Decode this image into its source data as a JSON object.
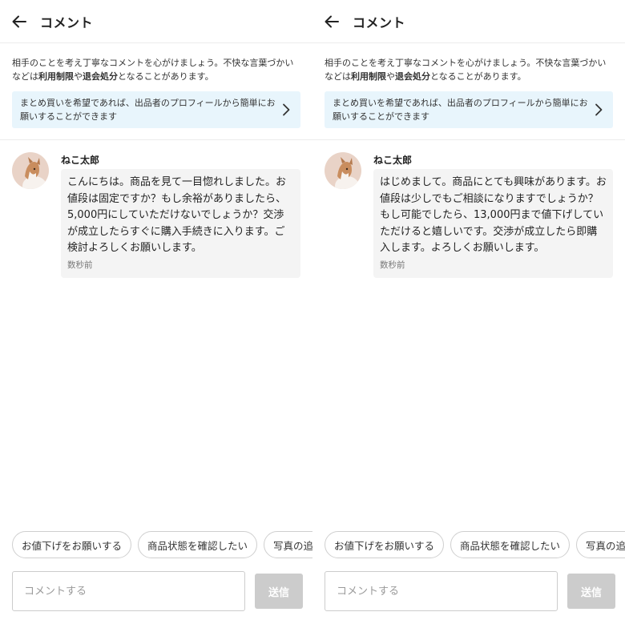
{
  "panels": [
    {
      "header": {
        "title": "コメント",
        "back_icon": "arrow-left-icon"
      },
      "notice": {
        "pre": "相手のことを考え丁寧なコメントを心がけましょう。不快な言葉づかいなどは",
        "bold1": "利用制限",
        "mid": "や",
        "bold2": "退会処分",
        "post": "となることがあります。"
      },
      "banner": {
        "text": "まとめ買いを希望であれば、出品者のプロフィールから簡単にお願いすることができます",
        "icon": "chevron-right-icon",
        "background": "#e8f5fc"
      },
      "comment": {
        "username": "ねこ太郎",
        "text": "こんにちは。商品を見て一目惚れしました。お値段は固定ですか？もし余裕がありましたら、5,000円にしていただけないでしょうか？交渉が成立したらすぐに購入手続きに入ります。ご検討よろしくお願いします。",
        "timestamp": "数秒前"
      },
      "chips": [
        "お値下げをお願いする",
        "商品状態を確認したい",
        "写真の追加をお願いする"
      ],
      "composer": {
        "placeholder": "コメントする",
        "send_label": "送信"
      }
    },
    {
      "header": {
        "title": "コメント",
        "back_icon": "arrow-left-icon"
      },
      "notice": {
        "pre": "相手のことを考え丁寧なコメントを心がけましょう。不快な言葉づかいなどは",
        "bold1": "利用制限",
        "mid": "や",
        "bold2": "退会処分",
        "post": "となることがあります。"
      },
      "banner": {
        "text": "まとめ買いを希望であれば、出品者のプロフィールから簡単にお願いすることができます",
        "icon": "chevron-right-icon",
        "background": "#e8f5fc"
      },
      "comment": {
        "username": "ねこ太郎",
        "text": "はじめまして。商品にとても興味があります。お値段は少しでもご相談になりますでしょうか？もし可能でしたら、13,000円まで値下げしていただけると嬉しいです。交渉が成立したら即購入します。よろしくお願いします。",
        "timestamp": "数秒前"
      },
      "chips": [
        "お値下げをお願いする",
        "商品状態を確認したい",
        "写真の追加をお願いする"
      ],
      "composer": {
        "placeholder": "コメントする",
        "send_label": "送信"
      }
    }
  ],
  "colors": {
    "send_disabled": "#cccccc",
    "bubble": "#f4f4f4",
    "divider": "#ececec"
  }
}
